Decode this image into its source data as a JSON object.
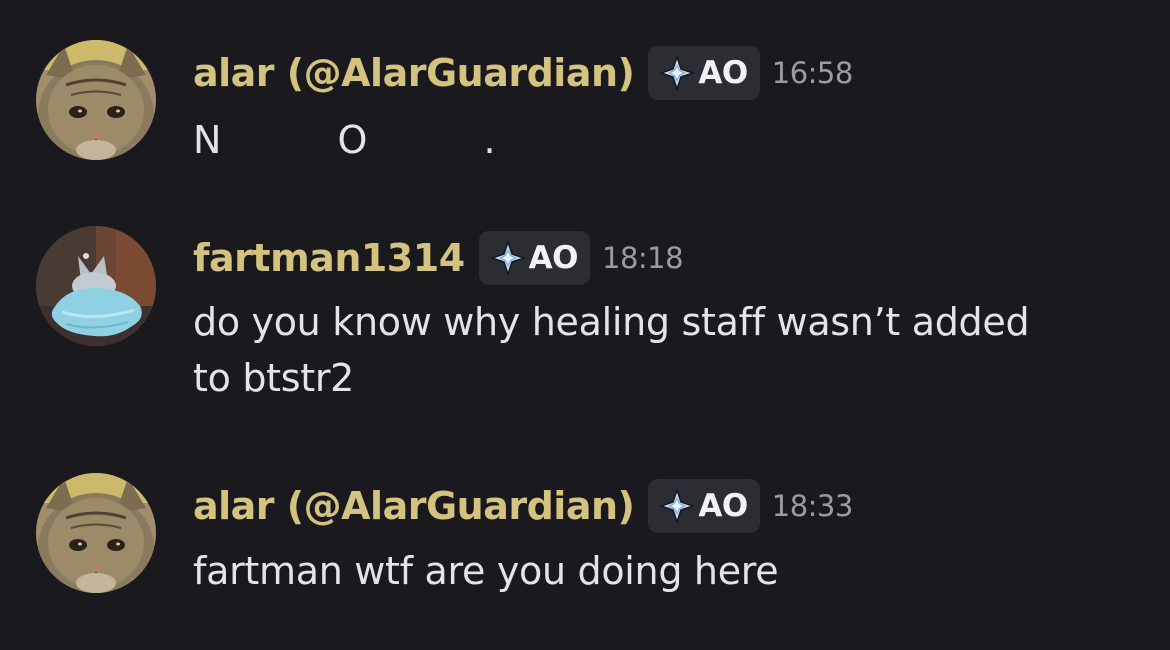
{
  "messages": [
    {
      "username": "alar (@AlarGuardian)",
      "tag": "AO",
      "time": "16:58",
      "content": "N O .",
      "avatar": "cat-avatar"
    },
    {
      "username": "fartman1314",
      "tag": "AO",
      "time": "18:18",
      "content_lines": [
        "do you know why healing staff wasn’t added",
        "to btstr2"
      ],
      "avatar": "ghost-avatar"
    },
    {
      "username": "alar (@AlarGuardian)",
      "tag": "AO",
      "time": "18:33",
      "content": "fartman wtf are you doing here",
      "avatar": "cat-avatar"
    }
  ],
  "colors": {
    "background": "#1a1a1e",
    "username": "#d4c27f",
    "text": "#e3e4e8",
    "timestamp": "#9a9ca3",
    "tag_bg": "#2c2d33"
  }
}
